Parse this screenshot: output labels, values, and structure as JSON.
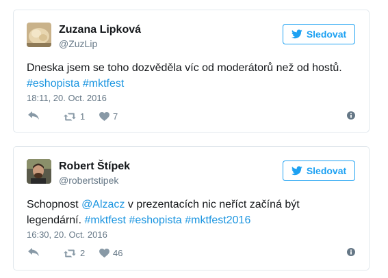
{
  "tweets": [
    {
      "author_name": "Zuzana Lipková",
      "handle": "@ZuzLip",
      "follow_label": "Sledovat",
      "text_parts": [
        {
          "type": "text",
          "value": "Dneska jsem se toho dozvěděla víc od moderátorů než od hostů. "
        },
        {
          "type": "hashtag",
          "value": "#eshopista"
        },
        {
          "type": "text",
          "value": " "
        },
        {
          "type": "hashtag",
          "value": "#mktfest"
        }
      ],
      "timestamp": "18:11, 20. Oct. 2016",
      "retweets": "1",
      "likes": "7",
      "avatar_icon": "bread-photo"
    },
    {
      "author_name": "Robert Štípek",
      "handle": "@robertstipek",
      "follow_label": "Sledovat",
      "text_parts": [
        {
          "type": "text",
          "value": "Schopnost "
        },
        {
          "type": "mention",
          "value": "@Alzacz"
        },
        {
          "type": "text",
          "value": " v prezentacích nic neříct začíná být legendární. "
        },
        {
          "type": "hashtag",
          "value": "#mktfest"
        },
        {
          "type": "text",
          "value": " "
        },
        {
          "type": "hashtag",
          "value": "#eshopista"
        },
        {
          "type": "text",
          "value": " "
        },
        {
          "type": "hashtag",
          "value": "#mktfest2016"
        }
      ],
      "timestamp": "16:30, 20. Oct. 2016",
      "retweets": "2",
      "likes": "46",
      "avatar_icon": "man-portrait-photo"
    }
  ],
  "colors": {
    "link": "#1b95e0",
    "brand": "#1da1f2",
    "muted": "#657786",
    "border": "#e1e8ed"
  }
}
